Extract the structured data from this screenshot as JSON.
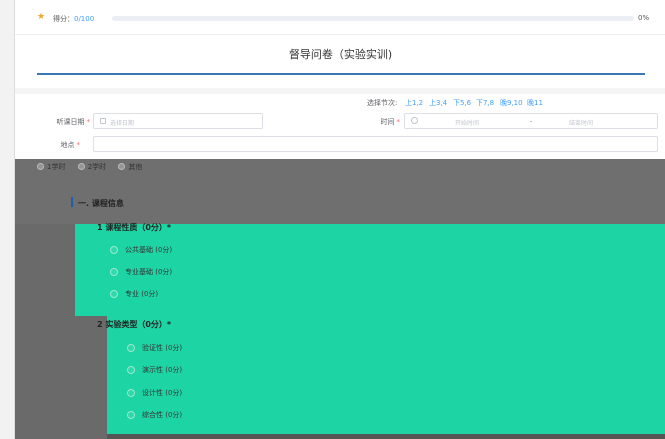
{
  "score": {
    "label": "得分：",
    "value": "0/100",
    "percent": "0%",
    "progress": 0
  },
  "title": "督导问卷（实验实训)",
  "form": {
    "sessions_label": "选择节次:",
    "sessions": [
      "上1,2",
      "上3,4",
      "下5,6",
      "下7,8",
      "晚9,10",
      "晚11"
    ],
    "date_label": "听课日期",
    "date_placeholder": "选择日期",
    "time_label": "时间",
    "start_placeholder": "开始时间",
    "range_sep": "-",
    "end_placeholder": "结束时间",
    "location_label": "地点",
    "required_mark": "*"
  },
  "partial_row": {
    "options": [
      "1学时",
      "2学时",
      "其他"
    ]
  },
  "section": {
    "title": "一. 课程信息"
  },
  "questions": [
    {
      "title": "1  课程性质（0分）*",
      "options": [
        "公共基础 (0分)",
        "专业基础 (0分)",
        "专业 (0分)"
      ]
    },
    {
      "title": "2  实验类型（0分）*",
      "options": [
        "验证性 (0分)",
        "演示性 (0分)",
        "设计性 (0分)",
        "综合性 (0分)"
      ]
    }
  ],
  "colors": {
    "accent": "#409eff",
    "teal": "#1dd4a4",
    "rule": "#3a77b8"
  }
}
